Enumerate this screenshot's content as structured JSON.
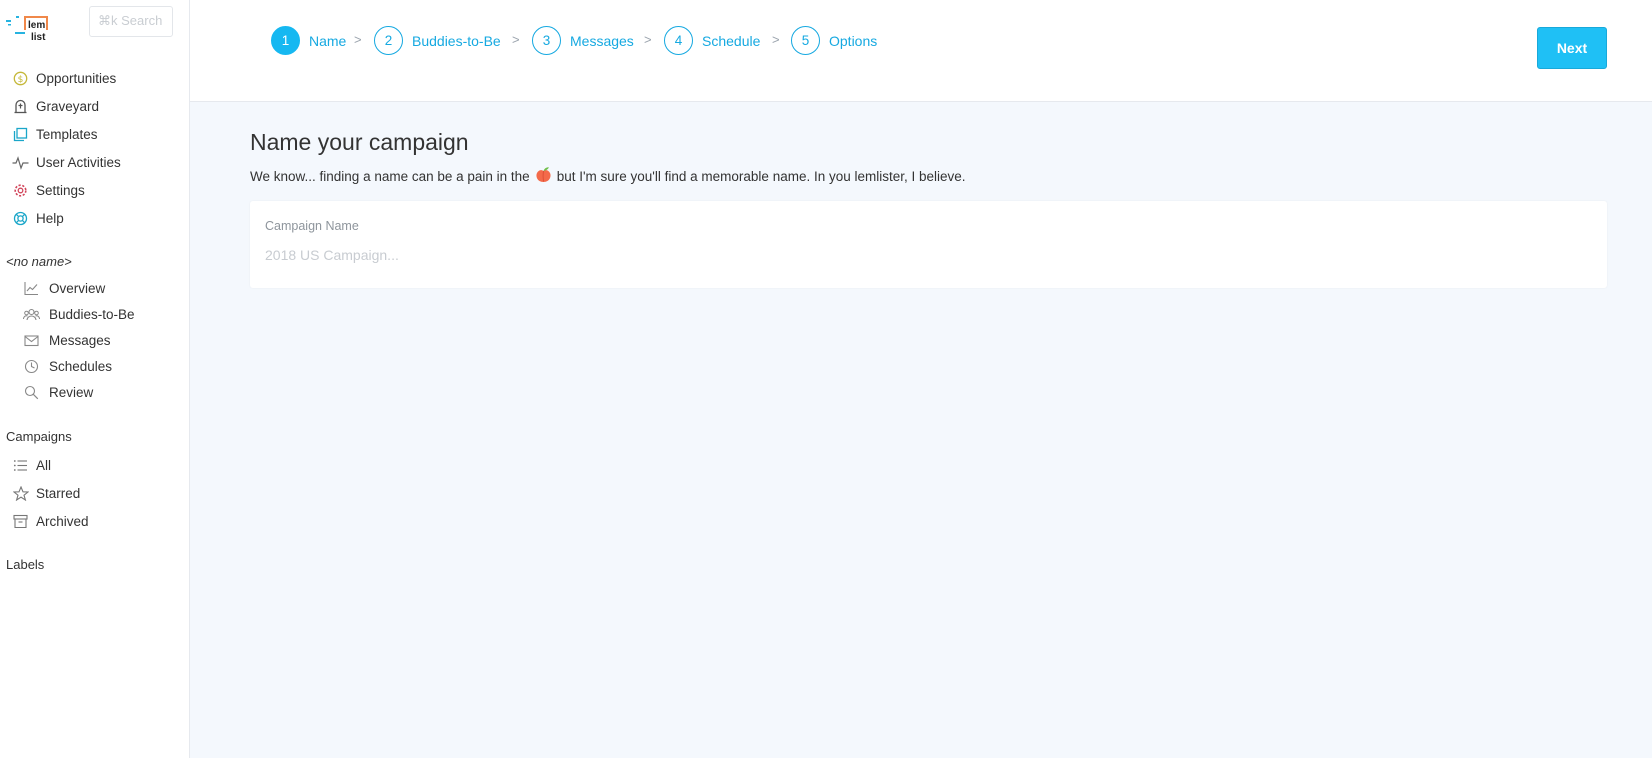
{
  "app": {
    "logo_text_top": "lem",
    "logo_text_bottom": "list"
  },
  "search": {
    "placeholder": "⌘k Search"
  },
  "sidebar": {
    "main_items": [
      {
        "label": "Opportunities",
        "icon": "dollar-coin-icon"
      },
      {
        "label": "Graveyard",
        "icon": "tombstone-icon"
      },
      {
        "label": "Templates",
        "icon": "copy-icon"
      },
      {
        "label": "User Activities",
        "icon": "pulse-icon"
      },
      {
        "label": "Settings",
        "icon": "gear-icon"
      },
      {
        "label": "Help",
        "icon": "lifebuoy-icon"
      }
    ],
    "campaign_name": "<no name>",
    "campaign_items": [
      {
        "label": "Overview",
        "icon": "chart-icon"
      },
      {
        "label": "Buddies-to-Be",
        "icon": "users-icon"
      },
      {
        "label": "Messages",
        "icon": "envelope-icon"
      },
      {
        "label": "Schedules",
        "icon": "clock-icon"
      },
      {
        "label": "Review",
        "icon": "search-icon"
      }
    ],
    "campaigns_title": "Campaigns",
    "campaigns_items": [
      {
        "label": "All",
        "icon": "list-icon"
      },
      {
        "label": "Starred",
        "icon": "star-icon"
      },
      {
        "label": "Archived",
        "icon": "archive-icon"
      }
    ],
    "labels_title": "Labels"
  },
  "steps": [
    {
      "num": "1",
      "label": "Name",
      "active": true
    },
    {
      "num": "2",
      "label": "Buddies-to-Be",
      "active": false
    },
    {
      "num": "3",
      "label": "Messages",
      "active": false
    },
    {
      "num": "4",
      "label": "Schedule",
      "active": false
    },
    {
      "num": "5",
      "label": "Options",
      "active": false
    }
  ],
  "step_separator": ">",
  "next_button": "Next",
  "main": {
    "title": "Name your campaign",
    "subtitle_before": "We know... finding a name can be a pain in the",
    "subtitle_after": "but I'm sure you'll find a memorable name. In you lemlister, I believe.",
    "field_label": "Campaign Name",
    "field_placeholder": "2018 US Campaign...",
    "field_value": ""
  },
  "colors": {
    "accent": "#16a9e1",
    "button": "#1fc0f5",
    "main_bg": "#f4f8fd"
  }
}
